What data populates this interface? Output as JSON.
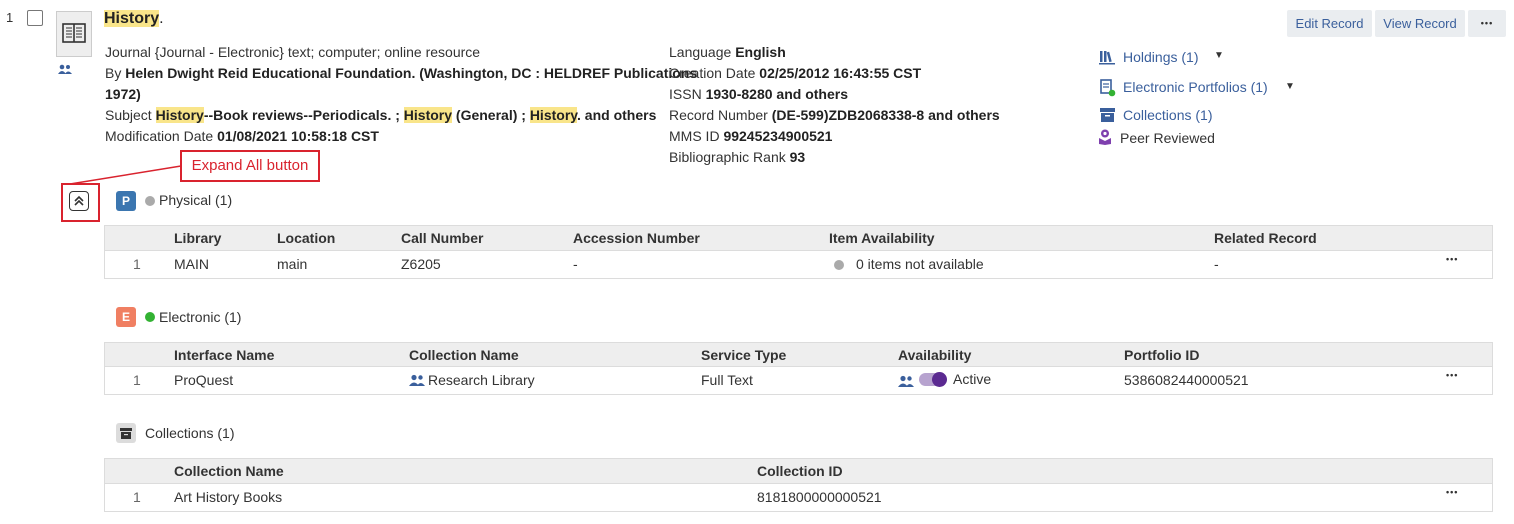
{
  "record": {
    "number": "1",
    "title": "History",
    "title_suffix": ".",
    "lines": {
      "type_line": "Journal {Journal - Electronic} text; computer; online resource",
      "by_prefix": "By ",
      "by_value": "Helen Dwight Reid Educational Foundation. (Washington, DC : HELDREF Publications",
      "by_value_cont": "1972)",
      "subject_prefix": "Subject ",
      "subject_h1": "History",
      "subject_t1": "--Book reviews--Periodicals. ; ",
      "subject_h2": "History",
      "subject_t2": " (General) ; ",
      "subject_h3": "History",
      "subject_t3": ". and others",
      "mod_label": "Modification Date ",
      "mod_value": "01/08/2021 10:58:18 CST"
    },
    "details": {
      "lang_label": "Language ",
      "lang_value": "English",
      "created_label": "Creation Date ",
      "created_value": "02/25/2012 16:43:55 CST",
      "issn_label": "ISSN ",
      "issn_value": "1930-8280 and others",
      "recnum_label": "Record Number ",
      "recnum_value": "(DE-599)ZDB2068338-8 and others",
      "mms_label": "MMS ID ",
      "mms_value": "99245234900521",
      "rank_label": "Bibliographic Rank ",
      "rank_value": "93"
    },
    "actions": {
      "edit": "Edit Record",
      "view": "View Record",
      "more": "•••"
    },
    "side_links": {
      "holdings": "Holdings (1)",
      "portfolios": "Electronic Portfolios (1)",
      "collections": "Collections (1)",
      "peer": "Peer Reviewed"
    }
  },
  "annotation": {
    "label": "Expand All button"
  },
  "physical": {
    "badge": "P",
    "label": "Physical (1)",
    "columns": [
      "Library",
      "Location",
      "Call Number",
      "Accession Number",
      "Item Availability",
      "Related Record"
    ],
    "row": {
      "num": "1",
      "library": "MAIN",
      "location": "main",
      "call_number": "Z6205",
      "accession": "-",
      "availability": "0 items not available",
      "related": "-"
    }
  },
  "electronic": {
    "badge": "E",
    "label": "Electronic (1)",
    "columns": [
      "Interface Name",
      "Collection Name",
      "Service Type",
      "Availability",
      "Portfolio ID"
    ],
    "row": {
      "num": "1",
      "interface": "ProQuest",
      "collection": "Research Library",
      "service": "Full Text",
      "availability": "Active",
      "portfolio_id": "5386082440000521"
    }
  },
  "collections": {
    "label": "Collections (1)",
    "columns": [
      "Collection Name",
      "Collection ID"
    ],
    "row": {
      "num": "1",
      "name": "Art History Books",
      "id": "8181800000000521"
    }
  },
  "colors": {
    "highlight": "#f9e58a",
    "link": "#3a5f9c",
    "physical_badge": "#3b76b0",
    "electronic_badge": "#f07f62",
    "green": "#33b233",
    "grey_dot": "#aaaaaa",
    "annotation_red": "#d9232e",
    "toggle_purple": "#5b2a91"
  }
}
